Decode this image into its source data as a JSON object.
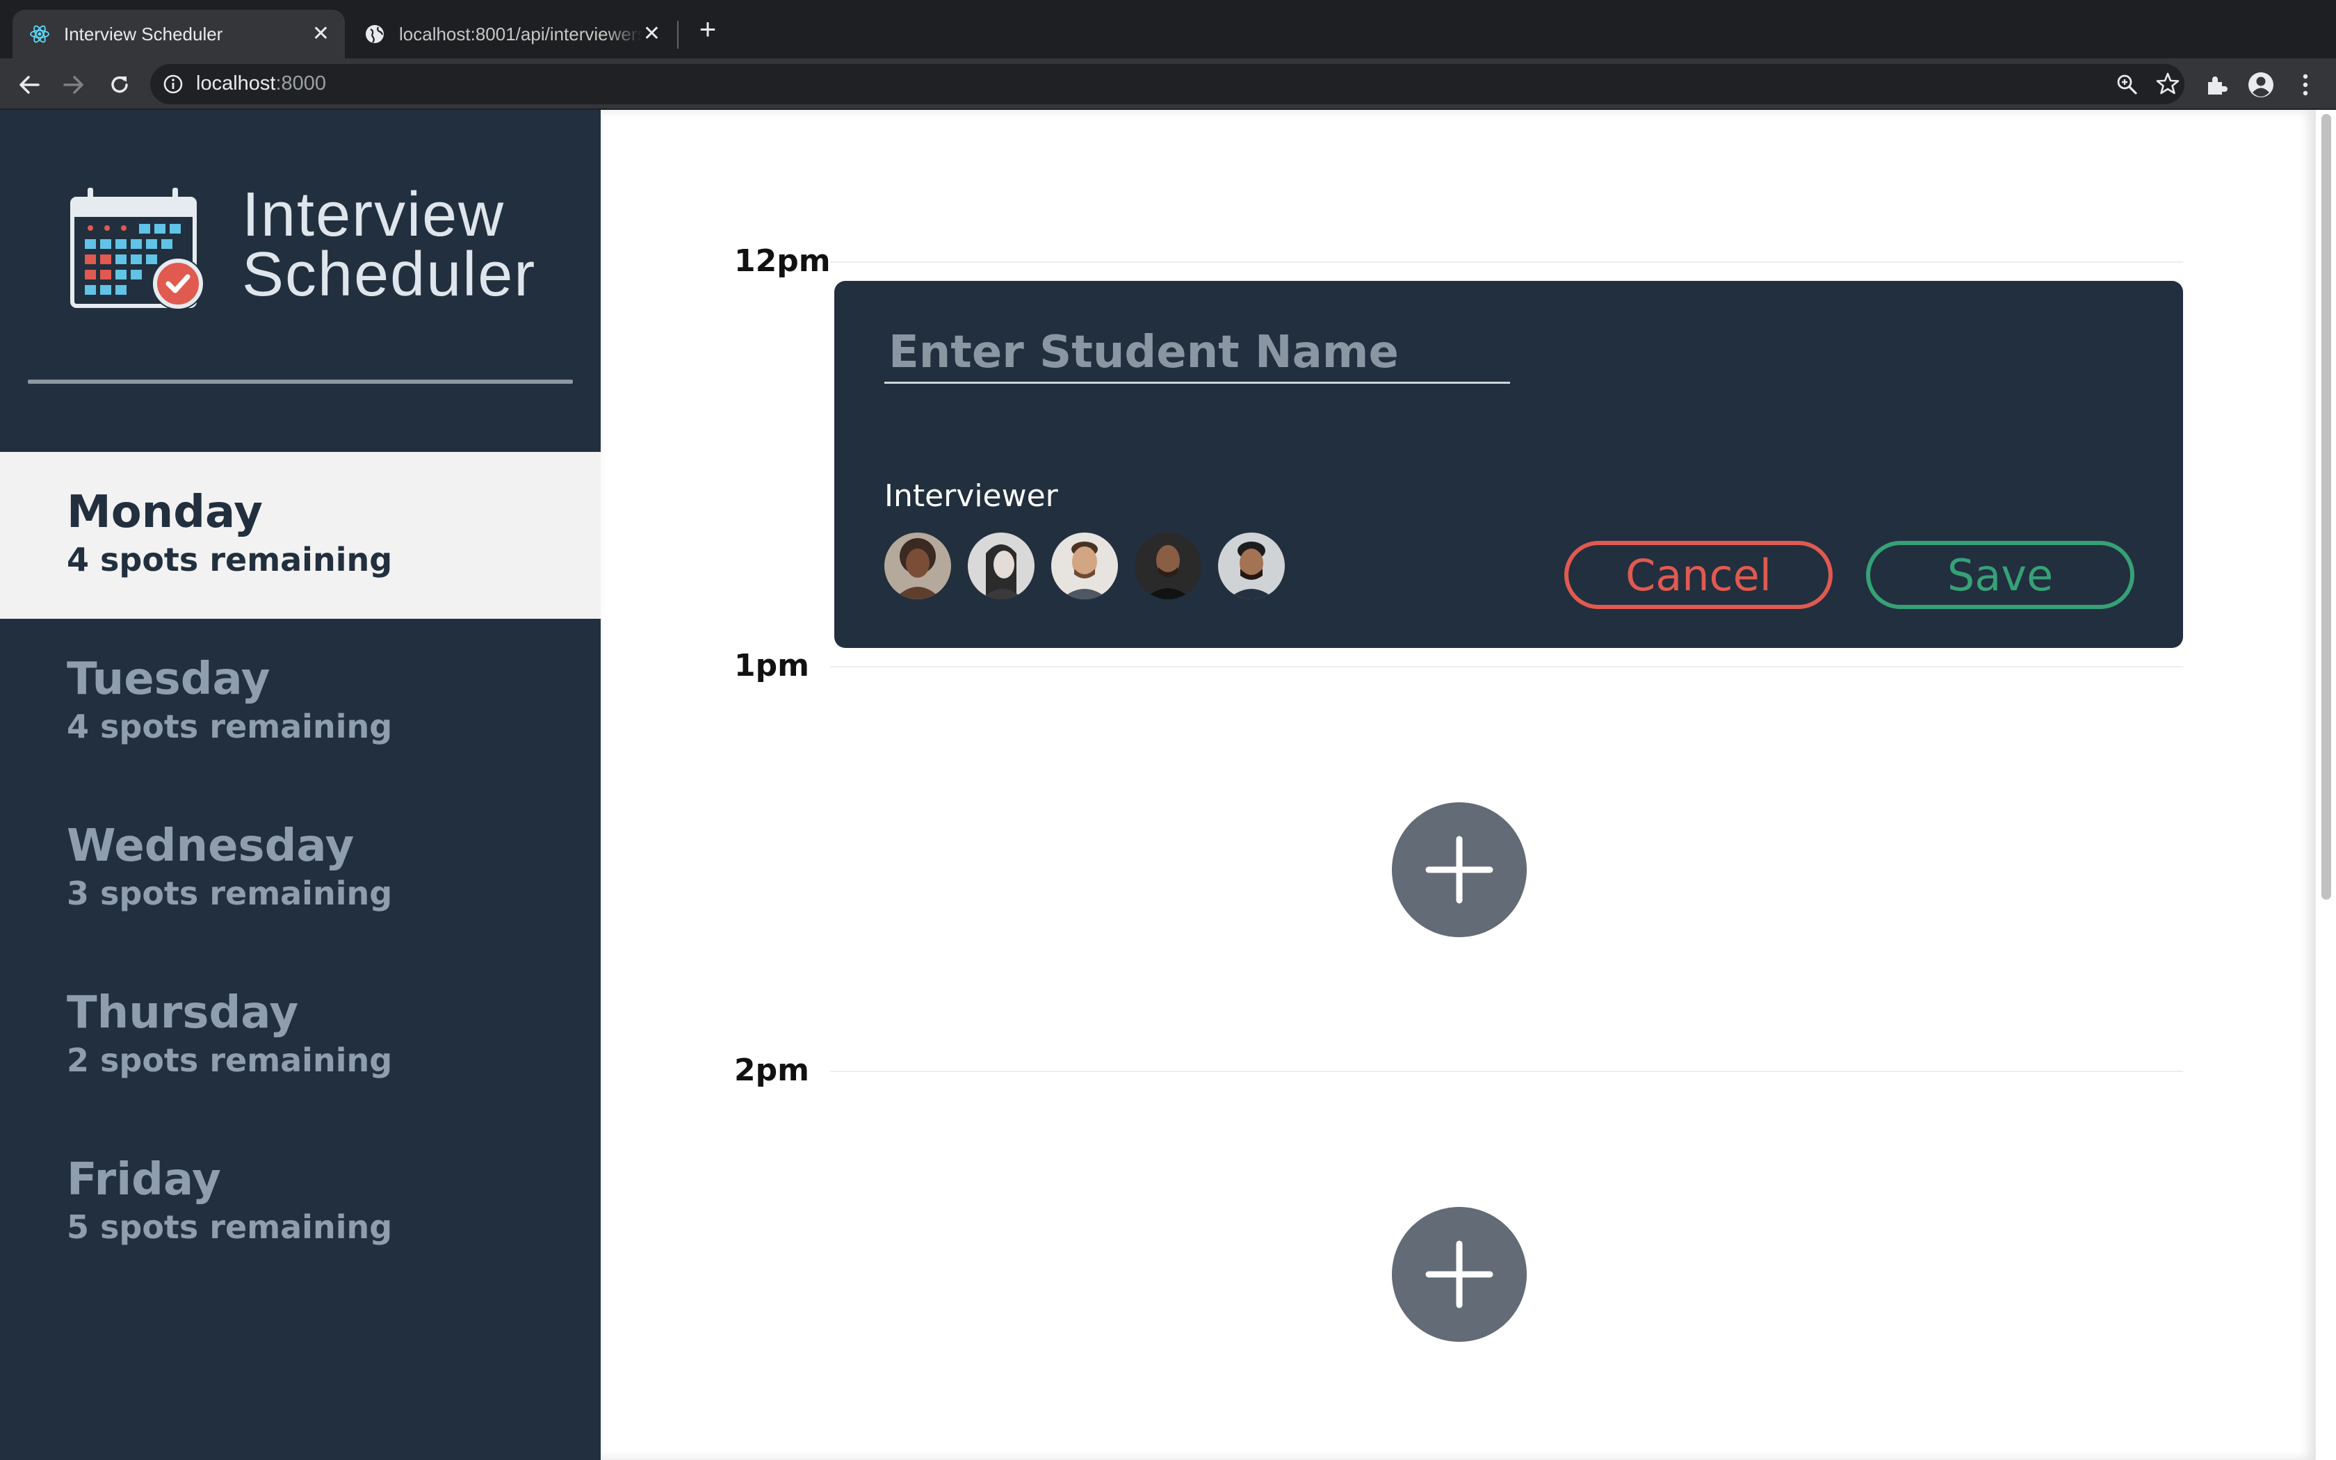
{
  "browser": {
    "tabs": [
      {
        "title": "Interview Scheduler",
        "icon": "react-favicon-icon",
        "active": true
      },
      {
        "title": "localhost:8001/api/interviewers",
        "icon": "globe-icon",
        "active": false
      }
    ],
    "close_glyph": "✕",
    "new_tab_glyph": "+",
    "url_host": "localhost",
    "url_port": ":8000"
  },
  "sidebar": {
    "brand_line1": "Interview",
    "brand_line2": "Scheduler",
    "days": [
      {
        "name": "Monday",
        "spots": "4 spots remaining",
        "selected": true
      },
      {
        "name": "Tuesday",
        "spots": "4 spots remaining",
        "selected": false
      },
      {
        "name": "Wednesday",
        "spots": "3 spots remaining",
        "selected": false
      },
      {
        "name": "Thursday",
        "spots": "2 spots remaining",
        "selected": false
      },
      {
        "name": "Friday",
        "spots": "5 spots remaining",
        "selected": false
      }
    ]
  },
  "schedule": {
    "slots": [
      {
        "time": "12pm"
      },
      {
        "time": "1pm"
      },
      {
        "time": "2pm"
      }
    ],
    "form": {
      "student_placeholder": "Enter Student Name",
      "student_value": "",
      "interviewer_label": "Interviewer",
      "cancel_label": "Cancel",
      "save_label": "Save",
      "interviewer_count": 5
    }
  },
  "colors": {
    "sidebar_bg": "#222f3e",
    "cancel": "#e05a50",
    "save": "#36a177",
    "add_button": "#626b76"
  }
}
